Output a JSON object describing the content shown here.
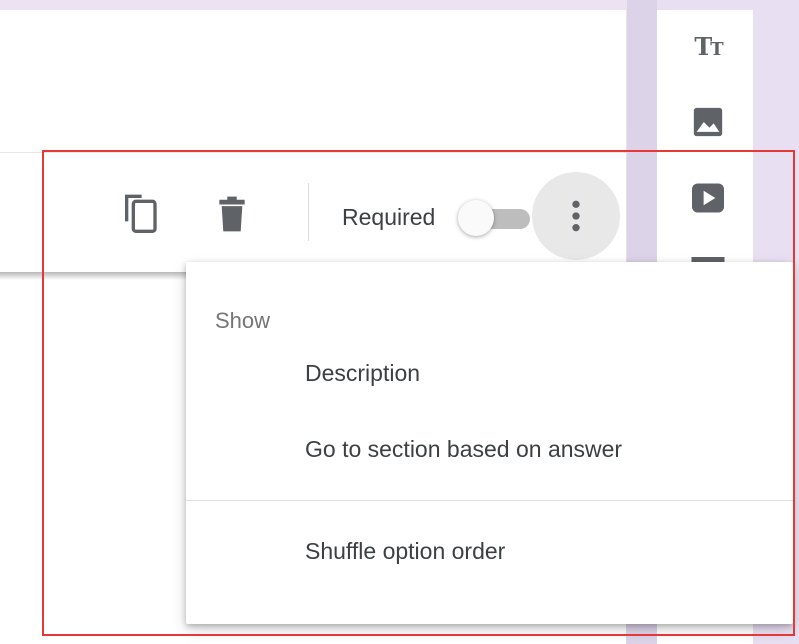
{
  "toolbar": {
    "required_label": "Required",
    "required_on": false
  },
  "side_tools": {
    "title_tool": {
      "glyph_big": "T",
      "glyph_small": "T",
      "icon": "title-text-icon"
    },
    "image_tool": {
      "icon": "image-icon"
    },
    "video_tool": {
      "icon": "video-icon"
    },
    "section_tool": {
      "icon": "section-icon"
    }
  },
  "menu": {
    "header": "Show",
    "items": [
      {
        "label": "Description"
      },
      {
        "label": "Go to section based on answer"
      },
      {
        "label": "Shuffle option order"
      }
    ]
  },
  "colors": {
    "icon_gray": "#5f6368",
    "highlight": "#e53935",
    "panel_bg": "#e9dff2"
  }
}
